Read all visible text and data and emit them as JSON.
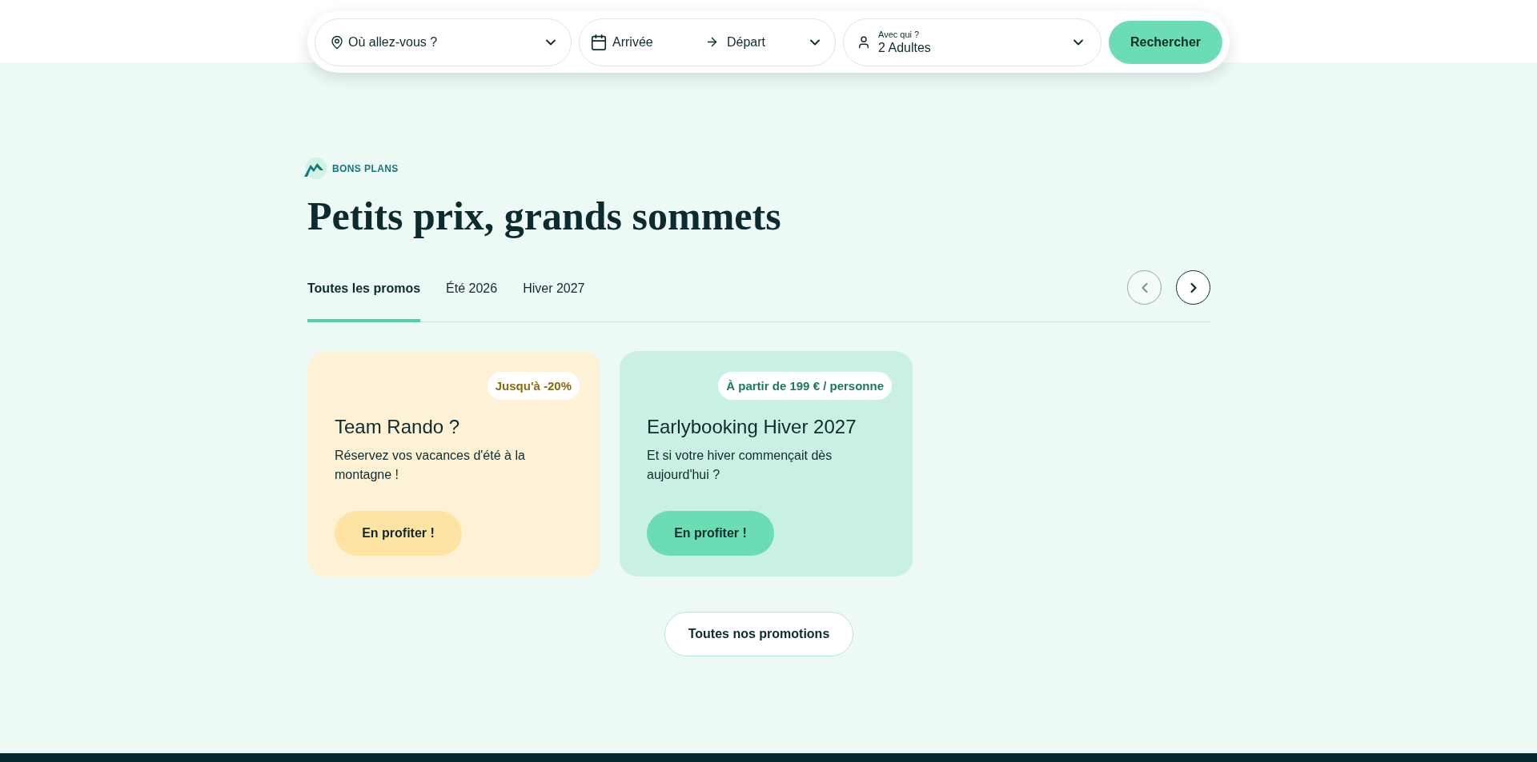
{
  "search_bar": {
    "destination": {
      "placeholder": "Où allez-vous ?"
    },
    "dates": {
      "arrival": "Arrivée",
      "departure": "Départ"
    },
    "guests": {
      "label": "Avec qui ?",
      "value": "2 Adultes"
    },
    "submit": "Rechercher"
  },
  "section": {
    "eyebrow": "BONS PLANS",
    "title": "Petits prix, grands sommets"
  },
  "tabs": [
    {
      "label": "Toutes les promos",
      "selected": true
    },
    {
      "label": "Été 2026",
      "selected": false
    },
    {
      "label": "Hiver 2027",
      "selected": false
    }
  ],
  "carousel_nav": [
    {
      "kind": "previous",
      "disabled": true
    },
    {
      "kind": "next",
      "disabled": false
    }
  ],
  "cards": [
    {
      "badge": "Jusqu'à -20%",
      "title": "Team Rando ?",
      "description": "Réservez vos vacances d'été à la montagne !",
      "button": "En profiter !",
      "color": "#fef2d6"
    },
    {
      "badge": "À partir de 199 € / personne",
      "title": "Earlybooking Hiver 2027",
      "description": "Et si votre hiver commençait dès aujourd'hui ?",
      "button": "En profiter !",
      "color": "#c9f1e3"
    }
  ],
  "all_promotions_button": "Toutes nos promotions"
}
